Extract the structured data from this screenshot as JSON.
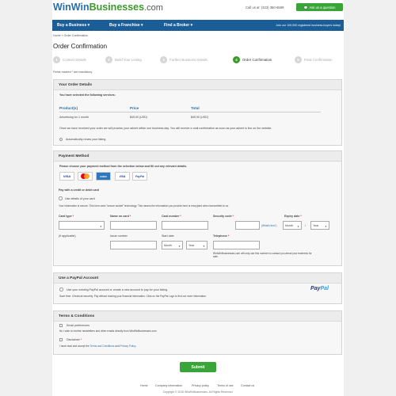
{
  "header": {
    "logo_part1": "WinWin",
    "logo_part2": "Businesses",
    "logo_part3": ".com",
    "call_us": "Call us at: (323) 350-6589",
    "ask_button": "Ask us a question",
    "ask_icon": "chat-bubble-icon"
  },
  "nav": {
    "items": [
      "Buy a Business ▾",
      "Buy a Franchise ▾",
      "Find a Broker ▾"
    ],
    "right_text": "Join our 100,000 registered business buyers today!"
  },
  "breadcrumb": {
    "home": "Home",
    "sep": "»",
    "current": "Order Confirmation"
  },
  "page_title": "Order Confirmation",
  "steps": [
    {
      "num": "1",
      "label": "Contact Details"
    },
    {
      "num": "2",
      "label": "Build Your Listing"
    },
    {
      "num": "3",
      "label": "Further Business Details"
    },
    {
      "num": "4",
      "label": "Order Confirmation"
    },
    {
      "num": "5",
      "label": "Final Confirmation"
    }
  ],
  "active_step": 4,
  "required_note": "Fields marked * are mandatory.",
  "order": {
    "heading": "Your Order Details",
    "subheading": "You have selected the following services:",
    "col_product": "Product(s)",
    "col_price": "Price",
    "col_total": "Total",
    "row_product": "Advertising for 1 month",
    "row_price": "$49.00 (USD)",
    "row_total": "$49.00 (USD)",
    "note": "Once we have received your order we will process your advert within one business day. You will receive e-mail confirmation as soon as your advert is live on the website.",
    "auto_renew": "Automatically renew your listing"
  },
  "payment": {
    "heading": "Payment Method",
    "subheading": "Please choose your payment method from the selection below and fill out any relevant details.",
    "cards": [
      "VISA",
      "MC",
      "AMEX",
      "VISA",
      "PayPal"
    ],
    "pay_with": "Pay with a credit or debit card",
    "use_card": "Use details of your card",
    "secure_note": "Your information is secure. This form uses \"secure socket\" technology. This means the information you provide here is encrypted when transmitted to us.",
    "labels": {
      "card_type": "Card type",
      "name_on_card": "Name on card",
      "card_number": "Card number",
      "security_code": "Security code",
      "expiry_date": "Expiry date",
      "issue_number": "Issue number",
      "start_date": "Start date",
      "telephone": "Telephone",
      "star": "*"
    },
    "if_applicable": "(If applicable)",
    "whats_this": "(What's this?)",
    "month": "Month",
    "year": "Year",
    "phone_note": "WinWinBusinesses.com will only use this number to contact you about your business for sale."
  },
  "paypal": {
    "heading": "Use a PayPal Account",
    "option": "Use your existing PayPal account or create a new account to pay for your listing.",
    "note": "Save time. Checkout securely. Pay without sharing your financial information. Click on the PayPal Logo to find out more information.",
    "logo_p1": "Pay",
    "logo_p2": "Pal"
  },
  "terms": {
    "heading": "Terms & Conditions",
    "email_pref": "Email preferences",
    "email_note": "No I wish to receive newsletters and other emails directly from WinWinBusinesses.com",
    "disclaimer": "Disclaimer",
    "read_prefix": "I have read and accept the ",
    "tc_link": "Terms and Conditions",
    "and": " and ",
    "privacy_link": "Privacy Policy"
  },
  "submit": "Submit",
  "footer": {
    "links": [
      "Home",
      "Company information",
      "Privacy policy",
      "Terms of use",
      "Contact us"
    ],
    "copyright": "Copyright © 2015 WinWinBusinesses. All Rights Reserved."
  },
  "colors": {
    "brand_blue": "#1b5e97",
    "brand_green": "#39a538",
    "link": "#2a6fa8"
  }
}
